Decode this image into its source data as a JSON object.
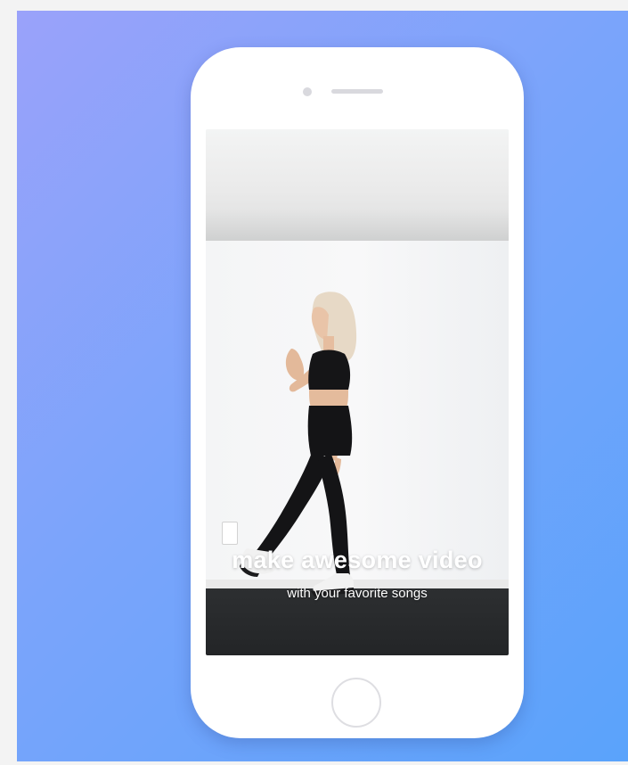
{
  "promo": {
    "headline": "make awesome video",
    "subheadline": "with your favorite songs"
  },
  "colors": {
    "background_start": "#9aa2fa",
    "background_end": "#5aa3fb",
    "phone_body": "#ffffff",
    "caption_text": "#ffffff"
  },
  "icons": {
    "camera": "front-camera-dot",
    "speaker": "earpiece-slot",
    "home": "home-button-ring"
  }
}
